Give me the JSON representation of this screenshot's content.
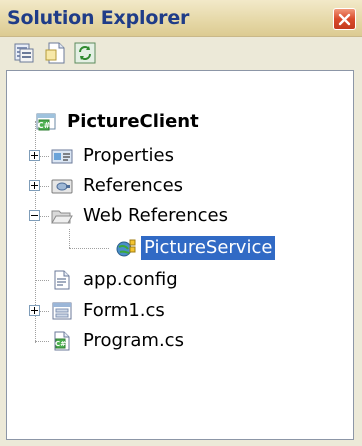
{
  "window": {
    "title": "Solution Explorer"
  },
  "toolbar": {
    "buttons": [
      {
        "name": "properties",
        "icon": "properties-icon"
      },
      {
        "name": "show-all-files",
        "icon": "show-all-files-icon"
      },
      {
        "name": "refresh",
        "icon": "refresh-icon"
      }
    ]
  },
  "tree": {
    "root": {
      "label": "PictureClient",
      "icon": "csharp-project-icon"
    },
    "items": [
      {
        "label": "Properties",
        "icon": "properties-folder-icon",
        "expander": "plus"
      },
      {
        "label": "References",
        "icon": "references-icon",
        "expander": "plus"
      },
      {
        "label": "Web References",
        "icon": "folder-open-icon",
        "expander": "minus"
      },
      {
        "label": "PictureService",
        "icon": "web-service-icon",
        "selected": true
      },
      {
        "label": "app.config",
        "icon": "config-file-icon"
      },
      {
        "label": "Form1.cs",
        "icon": "form-icon",
        "expander": "plus"
      },
      {
        "label": "Program.cs",
        "icon": "csharp-file-icon"
      }
    ]
  },
  "colors": {
    "title_text": "#1f3c88",
    "selection": "#316ac5",
    "close_button": "#d94a2a"
  }
}
